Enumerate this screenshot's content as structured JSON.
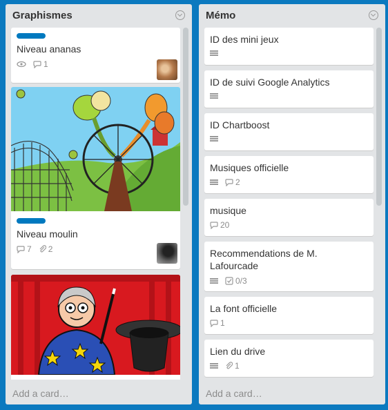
{
  "colors": {
    "board_bg": "#0b79bf",
    "label_blue": "#0079bf",
    "label_yellow": "#f2d600"
  },
  "lists": [
    {
      "title": "Graphismes",
      "add_card": "Add a card…",
      "cards": [
        {
          "title": "Niveau ananas",
          "label_color": "blue",
          "badges": {
            "watch": true,
            "comments": "1"
          },
          "avatar_icon": "cat-avatar"
        },
        {
          "title": "Niveau moulin",
          "label_color": "blue",
          "cover_icon": "ferris-wheel-illustration",
          "badges": {
            "comments": "7",
            "attachments": "2"
          },
          "avatar_icon": "silhouette-avatar"
        },
        {
          "cover_icon": "magician-illustration",
          "label_color": "yellow"
        }
      ]
    },
    {
      "title": "Mémo",
      "add_card": "Add a card…",
      "cards": [
        {
          "title": "ID des mini jeux",
          "badges": {
            "description": true
          }
        },
        {
          "title": "ID de suivi Google Analytics",
          "badges": {
            "description": true
          }
        },
        {
          "title": "ID Chartboost",
          "badges": {
            "description": true
          }
        },
        {
          "title": "Musiques officielle",
          "badges": {
            "description": true,
            "comments": "2"
          }
        },
        {
          "title": "musique",
          "badges": {
            "comments": "20"
          }
        },
        {
          "title": "Recommendations de M. Lafourcade",
          "badges": {
            "description": true,
            "checklist": "0/3"
          }
        },
        {
          "title": "La font officielle",
          "badges": {
            "comments": "1"
          }
        },
        {
          "title": "Lien du drive",
          "badges": {
            "description": true,
            "attachments": "1"
          }
        }
      ]
    }
  ]
}
